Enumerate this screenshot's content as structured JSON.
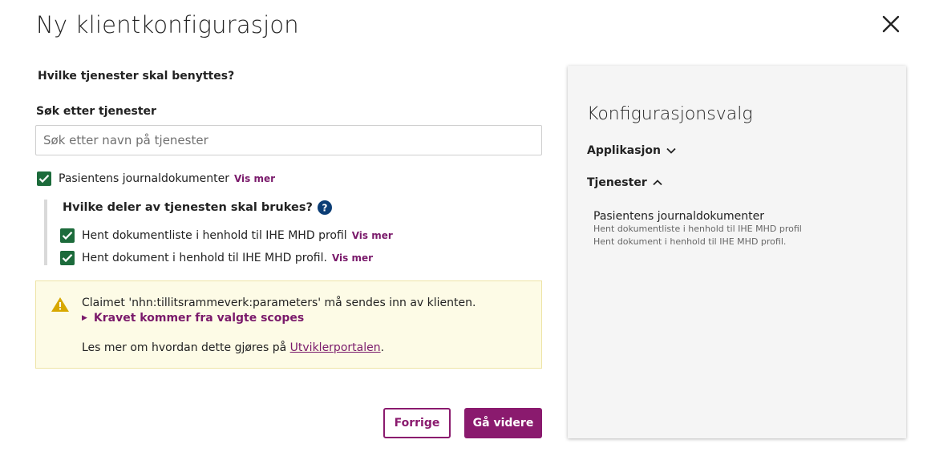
{
  "dialog": {
    "title": "Ny klientkonfigurasjon",
    "close_icon": "close-icon"
  },
  "form": {
    "question": "Hvilke tjenester skal benyttes?",
    "search": {
      "label": "Søk etter tjenester",
      "placeholder": "Søk etter navn på tjenester",
      "value": ""
    },
    "service": {
      "label": "Pasientens journaldokumenter",
      "checked": true,
      "vis_mer": "Vis mer"
    },
    "parts": {
      "heading": "Hvilke deler av tjenesten skal brukes?",
      "help_icon": "help-icon",
      "items": [
        {
          "label": "Hent dokumentliste i henhold til IHE MHD profil",
          "vis_mer": "Vis mer",
          "checked": true
        },
        {
          "label": "Hent dokument i henhold til IHE MHD profil.",
          "vis_mer": "Vis mer",
          "checked": true
        }
      ]
    },
    "warning": {
      "icon": "warning-icon",
      "text": "Claimet 'nhn:tillitsrammeverk:parameters' må sendes inn av klienten.",
      "toggle": "Kravet kommer fra valgte scopes",
      "read_more_prefix": "Les mer om hvordan dette gjøres på ",
      "link": "Utviklerportalen",
      "read_more_suffix": "."
    },
    "buttons": {
      "previous": "Forrige",
      "next": "Gå videre"
    }
  },
  "summary": {
    "title": "Konfigurasjonsvalg",
    "applikasjon": "Applikasjon",
    "tjenester": "Tjenester",
    "service_name": "Pasientens journaldokumenter",
    "service_parts": [
      "Hent dokumentliste i henhold til IHE MHD profil",
      "Hent dokument i henhold til IHE MHD profil."
    ]
  },
  "colors": {
    "accent": "#8a1a6e",
    "checkbox": "#1c6b3b",
    "warning_bg": "#fdfbe6",
    "panel_bg": "#f5f5f5"
  }
}
